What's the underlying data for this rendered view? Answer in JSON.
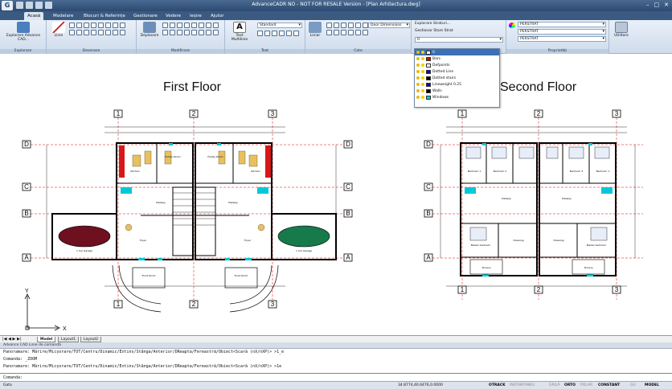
{
  "window": {
    "logo": "G",
    "title": "AdvanceCADR NO - NOT FOR RESALE Version - [Plan Arhitectura.dwg]",
    "min": "–",
    "max": "□",
    "close": "✕"
  },
  "tabs": [
    "Acasă",
    "Modelare",
    "Blocuri & Referințe",
    "Gestionare",
    "Vedere",
    "Ieșire",
    "Ajutor"
  ],
  "ribbon": {
    "explorer": {
      "label": "Explorare Advance CAD...",
      "group": "Explorare"
    },
    "draw": {
      "line": "Linie",
      "group": "Desenare"
    },
    "modify": {
      "move": "Deplasare",
      "group": "Modificare"
    },
    "text": {
      "multiline": "Text Multilinie",
      "style": "Standard",
      "group": "Text"
    },
    "dimensions": {
      "linear": "Liniar",
      "style": "Door Dimensions",
      "group": "Cote"
    },
    "layers": {
      "explore": "Explorare Straturi...",
      "state": "Gestionar Stare Strat",
      "current": "0"
    },
    "properties": {
      "color": "PERSTRAT",
      "linetype": "PERSTRAT",
      "lineweight": "PERSTRAT",
      "group": "Proprietăți"
    },
    "utilities": {
      "label": "Utilitare"
    }
  },
  "layer_list": [
    {
      "name": "0",
      "color": "#ffffff",
      "selected": true
    },
    {
      "name": "Bars",
      "color": "#e00000",
      "selected": false
    },
    {
      "name": "Defpoints",
      "color": "#ffffff",
      "selected": false
    },
    {
      "name": "Dotted Line",
      "color": "#0000e0",
      "selected": false
    },
    {
      "name": "Dotted stairs",
      "color": "#000000",
      "selected": false
    },
    {
      "name": "Lineweight 0.25",
      "color": "#0000e0",
      "selected": false
    },
    {
      "name": "Walls",
      "color": "#000000",
      "selected": false
    },
    {
      "name": "Windows",
      "color": "#00d0d0",
      "selected": false
    }
  ],
  "drawing": {
    "first_floor_title": "First Floor",
    "second_floor_title": "Second Floor",
    "axes_numbers": [
      "1",
      "2",
      "3"
    ],
    "axes_letters": [
      "D",
      "C",
      "B",
      "A"
    ],
    "first_floor_rooms": [
      "Kitchen",
      "Family Room",
      "Family Room",
      "Kitchen",
      "Hallway",
      "Hallway",
      "Foyer",
      "Foyer",
      "1 Car Garage",
      "1 Car Garage",
      "Front Porch",
      "Front Porch"
    ],
    "second_floor_rooms": [
      "Bedroom 1",
      "Bedroom 2",
      "Bedroom 3",
      "Bedroom 1",
      "Hallway",
      "Hallway",
      "Master bedroom",
      "Dressing",
      "Dressing",
      "Master bedroom",
      "Terrace",
      "Terrace"
    ],
    "ucs_x": "X",
    "ucs_y": "Y"
  },
  "layout_tabs": [
    "Model",
    "Layout1",
    "Layout2"
  ],
  "command": {
    "header": "Advance CAD Linie de comandă",
    "history": [
      "Panoramare:  Mărire/Micșorare/TOT/Centru/Dinamic/Extins/Stânga/Anterior/DReapta/Fereastră/Obiect<Scară (nX/nXP)> >1_e",
      "Comanda:  _ZOOM",
      "Panoramare:  Mărire/Micșorare/TOT/Centru/Dinamic/Extins/Stânga/Anterior/DReapta/Fereastră/Obiect<Scară (nX/nXP)> >1e"
    ],
    "prompt": "Comanda:"
  },
  "status": {
    "left": "Gata",
    "coords": "34.8774,40.6476,0.0000",
    "buttons": [
      "OTRACK",
      "INSTANTANEU",
      "GRILĂ",
      "ORTO",
      "POLAR",
      "CONSTANT",
      "GU",
      "MODEL"
    ],
    "on_buttons": [
      "OTRACK",
      "ORTO",
      "CONSTANT",
      "MODEL"
    ]
  },
  "colors": {
    "garage_car_left": "#6e1020",
    "garage_car_right": "#167a4a",
    "kitchen_red": "#d81818",
    "window_cyan": "#00c8d8",
    "axis_red": "#e00000"
  }
}
